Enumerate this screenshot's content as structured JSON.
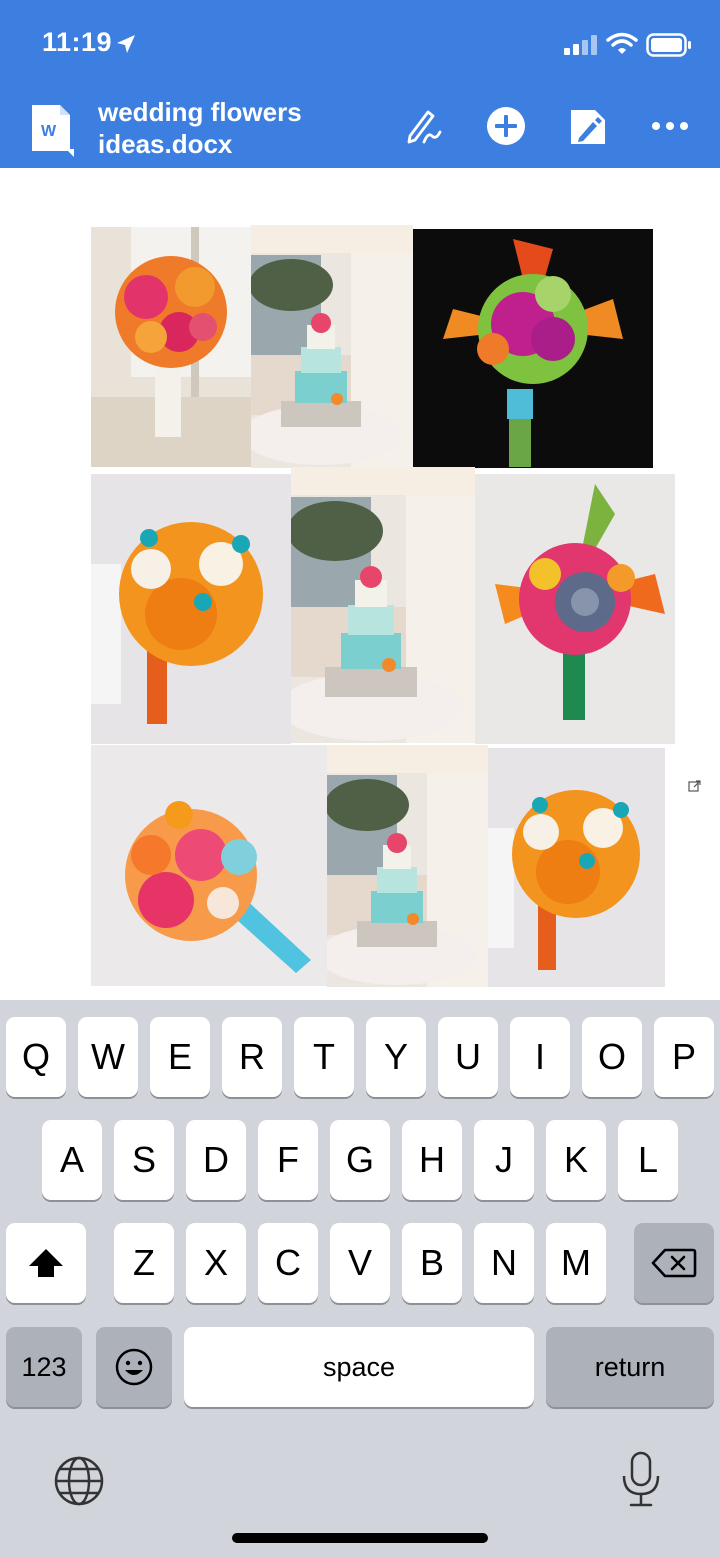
{
  "status_bar": {
    "time": "11:19"
  },
  "toolbar": {
    "doc_icon_letter": "W",
    "doc_title": "wedding flowers ideas.docx",
    "buttons": [
      {
        "name": "pen-icon"
      },
      {
        "name": "add-icon"
      },
      {
        "name": "edit-document-icon"
      },
      {
        "name": "more-icon"
      }
    ]
  },
  "document": {
    "images": [
      {
        "name": "orange-calla-lily-bouquet-image"
      },
      {
        "name": "turquoise-wedding-cake-image"
      },
      {
        "name": "bird-of-paradise-orchid-bouquet-image"
      },
      {
        "name": "orange-lily-turquoise-bouquet-image"
      },
      {
        "name": "turquoise-wedding-cake-image-2"
      },
      {
        "name": "succulent-protea-bouquet-image"
      },
      {
        "name": "pink-plumeria-turquoise-bouquet-image"
      },
      {
        "name": "turquoise-wedding-cake-image-3"
      },
      {
        "name": "orange-lily-turquoise-bouquet-image-2"
      }
    ],
    "link_icon": "external-link-icon"
  },
  "keyboard": {
    "row1": [
      "Q",
      "W",
      "E",
      "R",
      "T",
      "Y",
      "U",
      "I",
      "O",
      "P"
    ],
    "row2": [
      "A",
      "S",
      "D",
      "F",
      "G",
      "H",
      "J",
      "K",
      "L"
    ],
    "row3": [
      "Z",
      "X",
      "C",
      "V",
      "B",
      "N",
      "M"
    ],
    "numbers_label": "123",
    "space_label": "space",
    "return_label": "return",
    "icons": [
      "shift-icon",
      "backspace-icon",
      "emoji-icon",
      "globe-icon",
      "microphone-icon"
    ]
  },
  "colors": {
    "header_bg": "#3d7fe0",
    "keyboard_bg": "#d1d4db",
    "key_bg": "#ffffff",
    "dark_key_bg": "#acb1ba"
  }
}
